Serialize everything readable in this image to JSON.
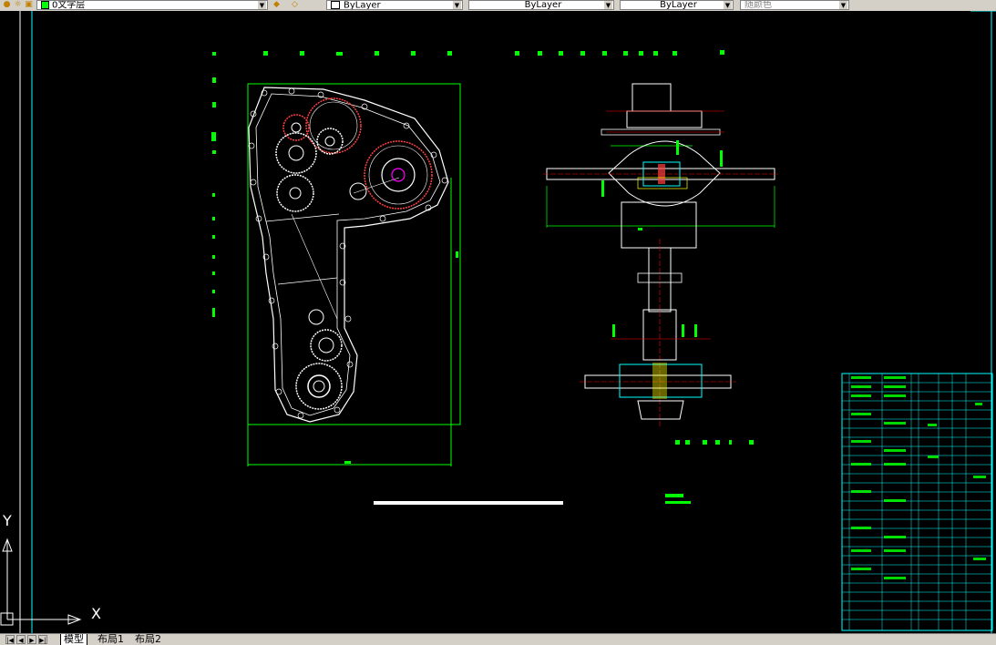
{
  "toolbar": {
    "layer_name": "0文字层",
    "color": "ByLayer",
    "linetype": "ByLayer",
    "lineweight": "ByLayer",
    "plot_style": "随颜色"
  },
  "tabs": [
    {
      "label": "模型",
      "active": true
    },
    {
      "label": "布局1",
      "active": false
    },
    {
      "label": "布局2",
      "active": false
    }
  ],
  "ucs": {
    "x_label": "X",
    "y_label": "Y"
  },
  "colors": {
    "background": "#000000",
    "geometry": "#ffffff",
    "dimension": "#00ff00",
    "gear": "#ff4040",
    "accent": "#00ffff",
    "centerline": "#ff0000",
    "tab_bg": "#d4d0c8"
  }
}
